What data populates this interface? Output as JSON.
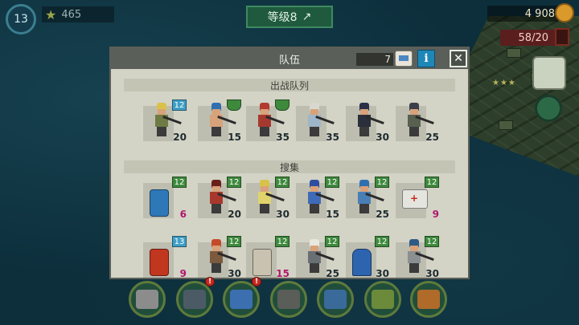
{
  "hud": {
    "level": "13",
    "stars": "465",
    "rank_label": "等级8",
    "coins": "4 908",
    "population": "58/20"
  },
  "dialog": {
    "title": "队伍",
    "count": "7",
    "info_label": "i",
    "close_label": "✕",
    "section_deployed": "出战队列",
    "section_gather": "搜集",
    "deployed": [
      {
        "badge": "12",
        "badge_type": "blue",
        "value": "20",
        "value_color": "dark",
        "hair": "#d9c24a",
        "shirt": "#6f7b44"
      },
      {
        "badge": "",
        "badge_type": "flag",
        "value": "15",
        "value_color": "dark",
        "hair": "#2f6fb0",
        "shirt": "#d8a27a"
      },
      {
        "badge": "",
        "badge_type": "flag",
        "value": "35",
        "value_color": "dark",
        "hair": "#b23a2f",
        "shirt": "#a6392f"
      },
      {
        "badge": "",
        "badge_type": "none",
        "value": "35",
        "value_color": "dark",
        "hair": "#d8d8d0",
        "shirt": "#9fb6c8"
      },
      {
        "badge": "",
        "badge_type": "none",
        "value": "30",
        "value_color": "dark",
        "hair": "#2a3048",
        "shirt": "#2b2f3b"
      },
      {
        "badge": "",
        "badge_type": "none",
        "value": "25",
        "value_color": "dark",
        "hair": "#3a3f4a",
        "shirt": "#58614f"
      }
    ],
    "gather_row1": [
      {
        "badge": "12",
        "badge_type": "green",
        "value": "6",
        "value_color": "pink",
        "item": "barrel-blue"
      },
      {
        "badge": "12",
        "badge_type": "green",
        "value": "20",
        "value_color": "dark",
        "hair": "#6b1f1a",
        "shirt": "#a8382c"
      },
      {
        "badge": "12",
        "badge_type": "green",
        "value": "30",
        "value_color": "dark",
        "hair": "#d9c24a",
        "shirt": "#e1d36c"
      },
      {
        "badge": "12",
        "badge_type": "green",
        "value": "15",
        "value_color": "dark",
        "hair": "#2d4ea0",
        "shirt": "#3f6ab8"
      },
      {
        "badge": "12",
        "badge_type": "green",
        "value": "25",
        "value_color": "dark",
        "hair": "#2f6fb0",
        "shirt": "#4a7fb6"
      },
      {
        "badge": "12",
        "badge_type": "green",
        "value": "9",
        "value_color": "pink",
        "item": "medkit"
      }
    ],
    "gather_row2": [
      {
        "badge": "13",
        "badge_type": "blue",
        "value": "9",
        "value_color": "pink",
        "item": "barrel-red"
      },
      {
        "badge": "12",
        "badge_type": "green",
        "value": "30",
        "value_color": "dark",
        "hair": "#c44a2a",
        "shirt": "#7b5a3e"
      },
      {
        "badge": "12",
        "badge_type": "green",
        "value": "15",
        "value_color": "pink",
        "item": "lamp"
      },
      {
        "badge": "12",
        "badge_type": "green",
        "value": "25",
        "value_color": "dark",
        "hair": "#e8e8e0",
        "shirt": "#6a6f74"
      },
      {
        "badge": "12",
        "badge_type": "green",
        "value": "30",
        "value_color": "dark",
        "item": "tank"
      },
      {
        "badge": "12",
        "badge_type": "green",
        "value": "30",
        "value_color": "dark",
        "hair": "#2f5a86",
        "shirt": "#8a8f92"
      }
    ]
  },
  "bottom_nav": [
    {
      "icon": "skull-icon",
      "color": "#8c8c8c",
      "alert": false
    },
    {
      "icon": "gamepad-icon",
      "color": "#4c5a66",
      "alert": true,
      "alert_label": "!"
    },
    {
      "icon": "radio-icon",
      "color": "#3b6fb0",
      "alert": true,
      "alert_label": "!"
    },
    {
      "icon": "terminal-icon",
      "color": "#5a5d58",
      "alert": false
    },
    {
      "icon": "tools-icon",
      "color": "#3a6a9a",
      "alert": false
    },
    {
      "icon": "soldier-icon",
      "color": "#6b8a3a",
      "alert": false
    },
    {
      "icon": "crate-icon",
      "color": "#b06a2a",
      "alert": false
    }
  ]
}
